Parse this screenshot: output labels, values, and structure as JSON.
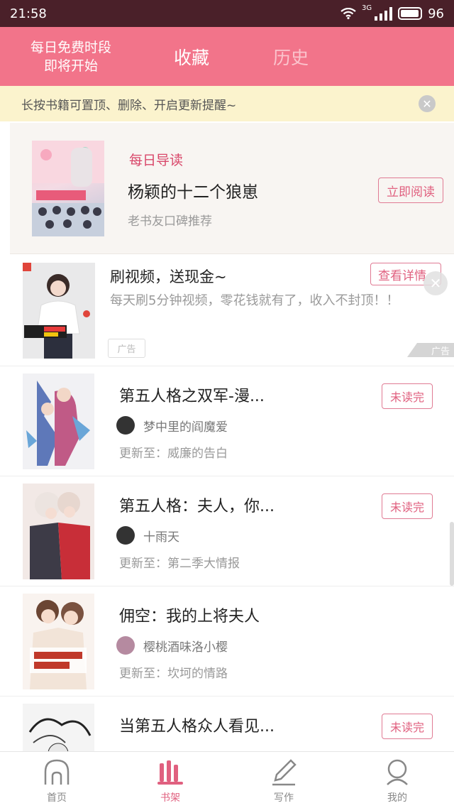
{
  "status_bar": {
    "time": "21:58",
    "network": "3G",
    "battery": "96"
  },
  "header": {
    "promo_line1": "每日免费时段",
    "promo_line2": "即将开始",
    "tab_favorites": "收藏",
    "tab_history": "历史"
  },
  "tip": {
    "text": "长按书籍可置顶、删除、开启更新提醒~"
  },
  "daily_read": {
    "label": "每日导读",
    "title": "杨颖的十二个狼崽",
    "subtitle": "老书友口碑推荐",
    "button": "立即阅读"
  },
  "ad": {
    "title": "刷视频，送现金~",
    "description": "每天刷5分钟视频，零花钱就有了，收入不封顶！！",
    "tag": "广告",
    "detail_button": "查看详情",
    "mark": "广告"
  },
  "books": [
    {
      "title": "第五人格之双军-漫...",
      "author": "梦中里的阎魔爱",
      "update": "更新至：威廉的告白",
      "status": "未读完"
    },
    {
      "title": "第五人格：夫人，你...",
      "author": "十雨天",
      "update": "更新至：第二季大情报",
      "status": "未读完"
    },
    {
      "title": "佣空：我的上将夫人",
      "author": "樱桃酒味洛小樱",
      "update": "更新至：坎坷的情路",
      "status": ""
    },
    {
      "title": "当第五人格众人看见...",
      "author": "",
      "update": "",
      "status": "未读完"
    }
  ],
  "bottom_nav": {
    "home": "首页",
    "shelf": "书架",
    "write": "写作",
    "me": "我的"
  },
  "colors": {
    "accent": "#f2748a",
    "status_bar": "#4a2029",
    "tip_bg": "#fbf3cd"
  }
}
